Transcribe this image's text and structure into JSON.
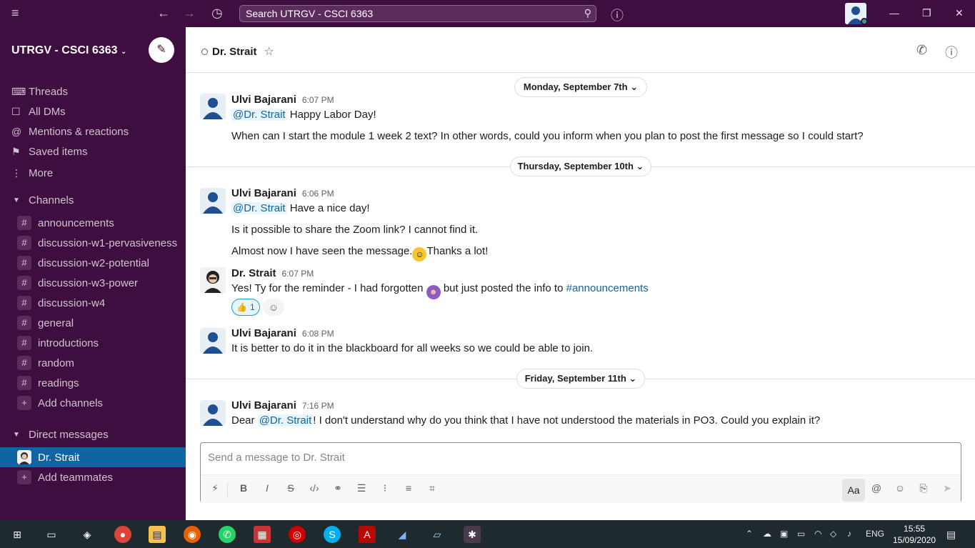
{
  "titlebar": {
    "search_text": "Search UTRGV - CSCI 6363",
    "icons": [
      "menu-icon",
      "back-arrow-icon",
      "forward-arrow-icon",
      "history-icon",
      "help-icon",
      "minimize-icon",
      "maximize-icon",
      "close-icon"
    ]
  },
  "sidebar": {
    "workspace": "UTRGV - CSCI 6363",
    "nav": [
      {
        "label": "Threads",
        "icon": "threads-icon"
      },
      {
        "label": "All DMs",
        "icon": "dm-icon"
      },
      {
        "label": "Mentions & reactions",
        "icon": "at-icon"
      },
      {
        "label": "Saved items",
        "icon": "bookmark-icon"
      },
      {
        "label": "More",
        "icon": "more-icon"
      }
    ],
    "channels_title": "Channels",
    "channels": [
      "announcements",
      "discussion-w1-pervasiveness",
      "discussion-w2-potential",
      "discussion-w3-power",
      "discussion-w4",
      "general",
      "introductions",
      "random",
      "readings"
    ],
    "add_channels": "Add channels",
    "dm_title": "Direct messages",
    "dms": [
      "Dr. Strait"
    ],
    "add_teammates": "Add teammates"
  },
  "header": {
    "title": "Dr. Strait"
  },
  "messages": {
    "day1": {
      "date": "Monday, September 7th",
      "name": "Ulvi Bajarani",
      "time": "6:07 PM",
      "mention": "@Dr. Strait",
      "line1_rest": "Happy Labor Day!",
      "line2": "When can I start the module 1 week 2 text? In other words, could you inform when you plan to post the first message so I could start?"
    },
    "day2": {
      "date": "Thursday, September 10th",
      "m1_name": "Ulvi Bajarani",
      "m1_time": "6:06 PM",
      "m1_mention": "@Dr. Strait",
      "m1_rest": "Have a nice day!",
      "m1_line2": "Is it possible to share the Zoom link? I cannot find it.",
      "m1_line3a": "Almost now I have seen the message.",
      "m1_line3b": "Thanks a lot!",
      "m2_name": "Dr. Strait",
      "m2_time": "6:07 PM",
      "m2_text_a": "Yes! Ty for the reminder - I had forgotten",
      "m2_text_b": "but just posted the info to",
      "m2_link": "#announcements",
      "reaction_count": "1",
      "m3_name": "Ulvi Bajarani",
      "m3_time": "6:08 PM",
      "m3_text": "It is better to do it in the blackboard for all weeks so we could be able to join."
    },
    "day3": {
      "date": "Friday, September 11th",
      "name": "Ulvi Bajarani",
      "time": "7:16 PM",
      "pre": "Dear",
      "mention": "@Dr. Strait",
      "rest": "! I don't understand why do you think that I have not understood the materials in PO3. Could you explain it?"
    }
  },
  "composer": {
    "placeholder": "Send a message to Dr. Strait",
    "format_label": "Aa"
  },
  "taskbar": {
    "time": "15:55",
    "date": "15/09/2020",
    "lang": "ENG"
  },
  "colors": {
    "sidebar_bg": "#3f0e40",
    "active_item": "#1164a3",
    "mention_bg": "#e8f5fa",
    "link": "#1264a3"
  }
}
